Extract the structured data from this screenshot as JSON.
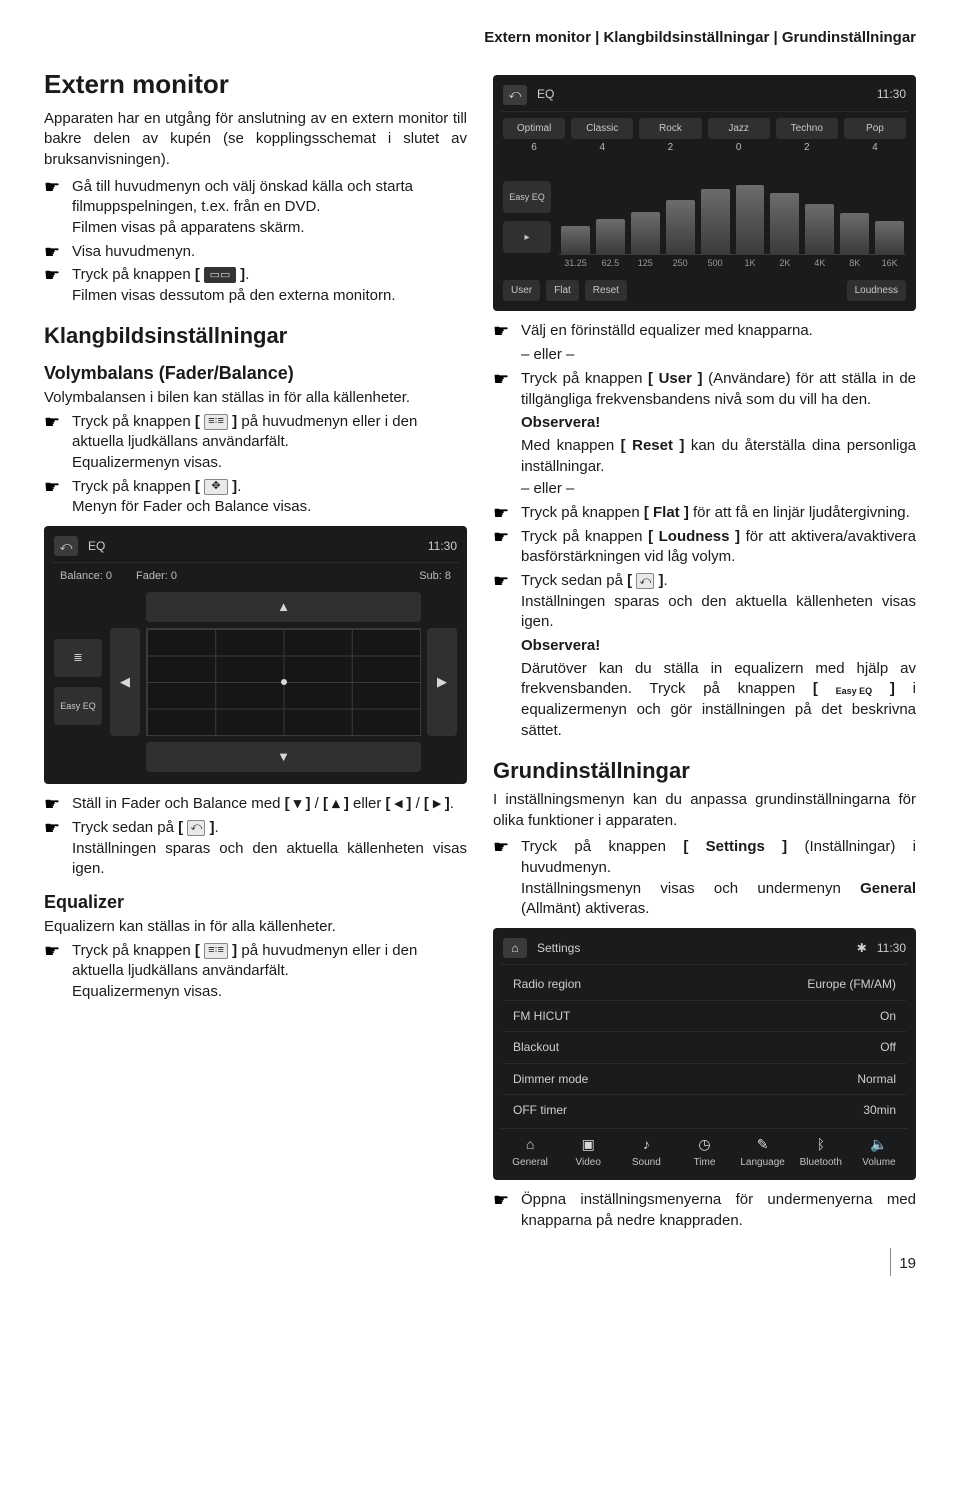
{
  "running_head": "Extern monitor | Klangbildsinställningar | Grundinställningar",
  "page_number": "19",
  "left": {
    "h1": "Extern monitor",
    "intro": "Apparaten har en utgång för anslutning av en extern monitor till bakre delen av kupén (se kopplingsschemat i slutet av bruksanvisningen).",
    "s1a": "Gå till huvudmenyn och välj önskad källa och starta filmuppspelningen, t.ex. från en DVD.",
    "s1b": "Filmen visas på apparatens skärm.",
    "s2": "Visa huvudmenyn.",
    "s3_pre": "Tryck på knappen ",
    "s3_post": ".",
    "s3b": "Filmen visas dessutom på den externa monitorn.",
    "h2a": "Klangbildsinställningar",
    "h3a": "Volymbalans (Fader/Balance)",
    "vb_intro": "Volymbalansen i bilen kan ställas in för alla källenheter.",
    "vb_s1_pre": "Tryck på knappen ",
    "vb_s1_post": " på huvudmenyn eller i den aktuella ljudkällans användarfält.",
    "vb_s1b": "Equalizermenyn visas.",
    "vb_s2_pre": "Tryck på knappen ",
    "vb_s2_post": ".",
    "vb_s2b": "Menyn för Fader och Balance visas.",
    "fb_screen": {
      "title": "EQ",
      "clock": "11:30",
      "balance": "Balance: 0",
      "fader": "Fader: 0",
      "sub": "Sub: 8",
      "list_icon": "≣",
      "easy_eq": "Easy EQ"
    },
    "vb_s3_pre": "Ställ in Fader och Balance med ",
    "vb_s3_mid": " / ",
    "vb_s3_mid2": " eller ",
    "vb_s3_end": " / ",
    "vb_s3_post": ".",
    "vb_s4_pre": "Tryck sedan på ",
    "vb_s4_post": ".",
    "vb_s4b": "Inställningen sparas och den aktuella källenheten visas igen.",
    "h3b": "Equalizer",
    "eq_intro": "Equalizern kan ställas in för alla källenheter.",
    "eq_s1_pre": "Tryck på knappen ",
    "eq_s1_post": " på huvudmenyn eller i den aktuella ljudkällans användarfält.",
    "eq_s1b": "Equalizermenyn visas."
  },
  "eq_screen": {
    "title": "EQ",
    "clock": "11:30",
    "presets": [
      "Optimal",
      "Classic",
      "Rock",
      "Jazz",
      "Techno",
      "Pop"
    ],
    "nums": [
      "6",
      "4",
      "2",
      "0",
      "2",
      "4"
    ],
    "easy_eq": "Easy EQ",
    "arrow": "▸",
    "freqs": [
      "31.25",
      "62.5",
      "125",
      "250",
      "500",
      "1K",
      "2K",
      "4K",
      "8K",
      "16K"
    ],
    "btn_user": "User",
    "btn_flat": "Flat",
    "btn_reset": "Reset",
    "btn_loudness": "Loudness"
  },
  "right": {
    "r1": "Välj en förinställd equalizer med knapparna.",
    "or": "– eller –",
    "r2_pre": "Tryck på knappen ",
    "r2_user": "[ User ]",
    "r2_post": " (Användare) för att ställa in de tillgängliga frekvensbandens nivå som du vill ha den.",
    "obs_title": "Observera!",
    "r_obs1_pre": "Med knappen ",
    "r_obs1_reset": "[ Reset ]",
    "r_obs1_post": " kan du återställa dina personliga inställningar.",
    "r3_pre": "Tryck på knappen ",
    "r3_flat": "[ Flat ]",
    "r3_post": " för att få en linjär ljudåtergivning.",
    "r4_pre": "Tryck på knappen ",
    "r4_loud": "[ Loudness ]",
    "r4_post": " för att aktivera/avaktivera basförstärkningen vid låg volym.",
    "r5_pre": "Tryck sedan på ",
    "r5_post": ".",
    "r5b": "Inställningen sparas och den aktuella källenheten visas igen.",
    "r_obs2_pre": "Därutöver kan du ställa in equalizern med hjälp av frekvensbanden. Tryck på knappen ",
    "r_obs2_post": " i equalizermenyn och gör inställningen på det beskrivna sättet.",
    "easy_eq_label": "Easy EQ",
    "h2b": "Grundinställningar",
    "g_intro": "I inställningsmenyn kan du anpassa grundinställningarna för olika funktioner i apparaten.",
    "g_s1_pre": "Tryck på knappen ",
    "g_s1_btn": "[ Settings ]",
    "g_s1_post": " (Inställningar) i huvudmenyn.",
    "g_s1b_a": "Inställningsmenyn visas och undermenyn ",
    "g_s1b_strong": "General",
    "g_s1b_b": " (Allmänt) aktiveras."
  },
  "settings_screen": {
    "title": "Settings",
    "clock": "11:30",
    "bt": "✱",
    "rows": [
      {
        "k": "Radio region",
        "v": "Europe (FM/AM)"
      },
      {
        "k": "FM HICUT",
        "v": "On"
      },
      {
        "k": "Blackout",
        "v": "Off"
      },
      {
        "k": "Dimmer mode",
        "v": "Normal"
      },
      {
        "k": "OFF timer",
        "v": "30min"
      }
    ],
    "tabs": [
      {
        "i": "⌂",
        "t": "General"
      },
      {
        "i": "▣",
        "t": "Video"
      },
      {
        "i": "♪",
        "t": "Sound"
      },
      {
        "i": "◷",
        "t": "Time"
      },
      {
        "i": "✎",
        "t": "Language"
      },
      {
        "i": "ᛒ",
        "t": "Bluetooth"
      },
      {
        "i": "🔈",
        "t": "Volume"
      }
    ]
  },
  "g_last": "Öppna inställningsmenyerna för undermenyerna med knapparna på nedre knappraden."
}
